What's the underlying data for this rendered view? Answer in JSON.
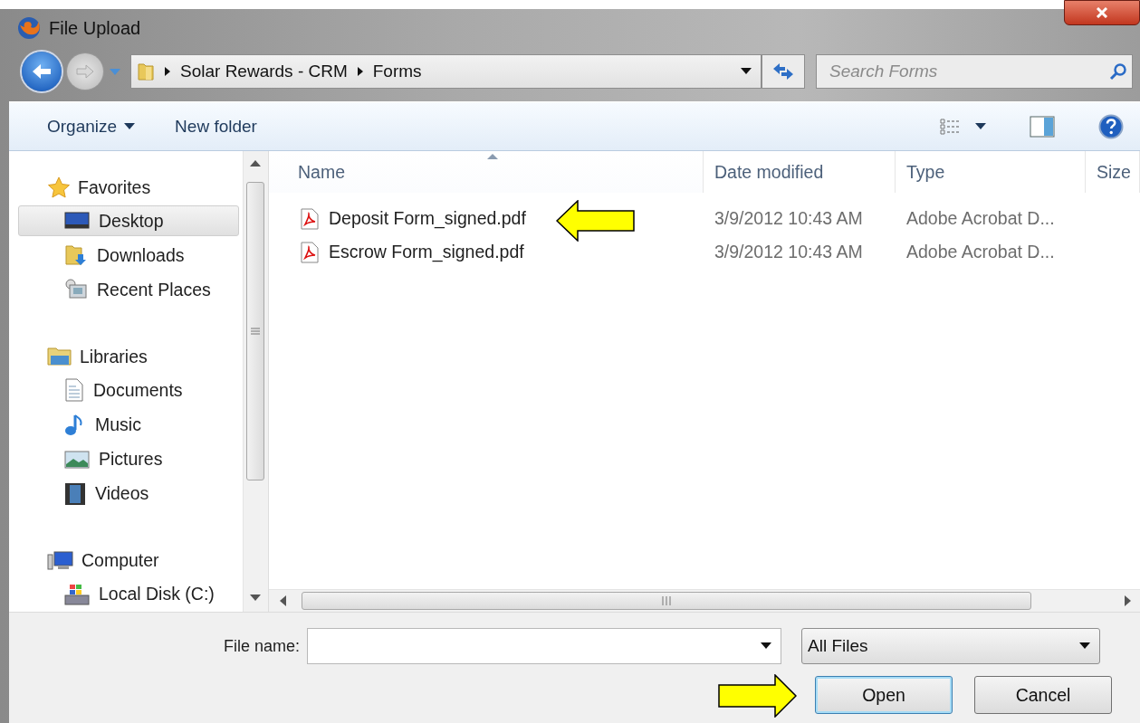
{
  "window": {
    "title": "File Upload"
  },
  "address": {
    "path": [
      "Solar Rewards - CRM",
      "Forms"
    ]
  },
  "search": {
    "placeholder": "Search Forms"
  },
  "toolbar": {
    "buttons": [
      "Organize",
      "New folder"
    ]
  },
  "navigation": [
    {
      "label": "Favorites",
      "children": [
        {
          "label": "Desktop",
          "selected": true
        },
        {
          "label": "Downloads",
          "selected": false
        },
        {
          "label": "Recent Places",
          "selected": false
        }
      ]
    },
    {
      "label": "Libraries",
      "children": [
        {
          "label": "Documents",
          "selected": false
        },
        {
          "label": "Music",
          "selected": false
        },
        {
          "label": "Pictures",
          "selected": false
        },
        {
          "label": "Videos",
          "selected": false
        }
      ]
    },
    {
      "label": "Computer",
      "children": [
        {
          "label": "Local Disk (C:)",
          "selected": false
        }
      ]
    }
  ],
  "table": {
    "columns": [
      {
        "label": "Name",
        "sorted": true
      },
      {
        "label": "Date modified",
        "sorted": false
      },
      {
        "label": "Type",
        "sorted": false
      },
      {
        "label": "Size",
        "sorted": false
      }
    ],
    "rows": [
      {
        "name": "Deposit Form_signed.pdf",
        "date": "3/9/2012 10:43 AM",
        "type": "Adobe Acrobat D..."
      },
      {
        "name": "Escrow Form_signed.pdf",
        "date": "3/9/2012 10:43 AM",
        "type": "Adobe Acrobat D..."
      }
    ]
  },
  "footer": {
    "file_name_label": "File name:",
    "file_type": "All Files",
    "buttons": [
      {
        "label": "Open",
        "default": true
      },
      {
        "label": "Cancel",
        "default": false
      }
    ]
  }
}
